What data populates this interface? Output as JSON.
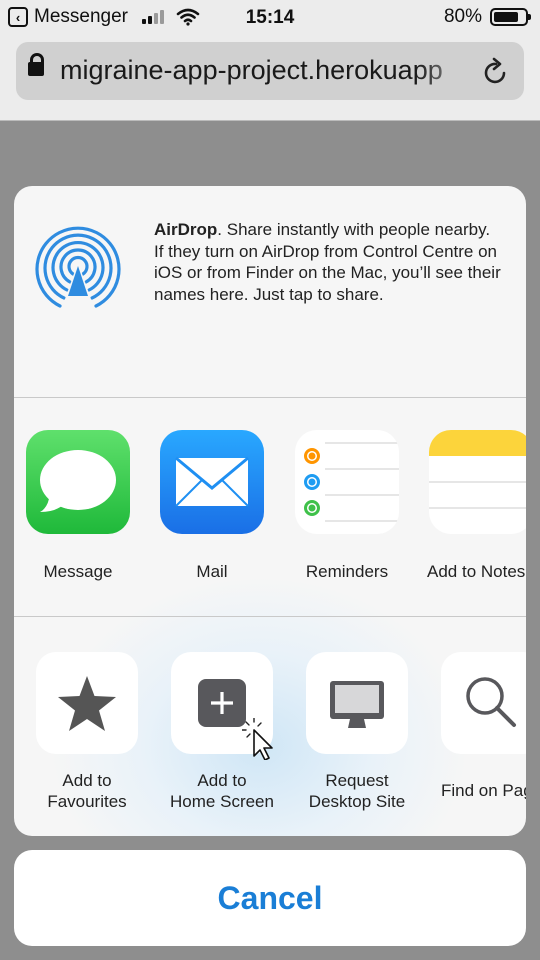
{
  "status": {
    "back_app": "Messenger",
    "time": "15:14",
    "battery": "80%",
    "battery_level": 0.8
  },
  "browser": {
    "url": "migraine-app-project.herokuapp"
  },
  "share_sheet": {
    "airdrop": {
      "title": "AirDrop",
      "description": ". Share instantly with people nearby. If they turn on AirDrop from Control Centre on iOS or from Finder on the Mac, you’ll see their names here. Just tap to share."
    },
    "apps": [
      {
        "label": "Message",
        "icon": "messages-icon"
      },
      {
        "label": "Mail",
        "icon": "mail-icon"
      },
      {
        "label": "Reminders",
        "icon": "reminders-icon"
      },
      {
        "label": "Add to Notes",
        "icon": "notes-icon"
      }
    ],
    "actions": [
      {
        "label": "Add to\nFavourites",
        "icon": "star-icon"
      },
      {
        "label": "Add to\nHome Screen",
        "icon": "add-square-icon"
      },
      {
        "label": "Request\nDesktop Site",
        "icon": "desktop-icon"
      },
      {
        "label": "Find on Page",
        "icon": "magnifier-icon"
      }
    ],
    "cancel_label": "Cancel"
  },
  "colors": {
    "accent_blue": "#1a7ed6",
    "messages_green": "#2fc74a",
    "mail_blue": "#1f8ff2",
    "notes_yellow": "#fcd43b"
  }
}
